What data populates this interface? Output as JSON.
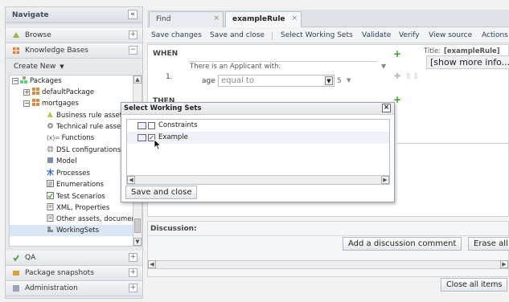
{
  "nav": {
    "title": "Navigate",
    "collapse_icon": "double-chevron-left-icon",
    "sections": {
      "browse": "Browse",
      "knowledge_bases": "Knowledge Bases",
      "create_new": "Create New",
      "qa": "QA",
      "package_snapshots": "Package snapshots",
      "administration": "Administration"
    },
    "tree": {
      "packages": "Packages",
      "default_package": "defaultPackage",
      "mortgages": "mortgages",
      "items": [
        "Business rule assets",
        "Technical rule assets",
        "Functions",
        "DSL configurations",
        "Model",
        "Processes",
        "Enumerations",
        "Test Scenarios",
        "XML, Properties",
        "Other assets, documenta",
        "WorkingSets"
      ],
      "functions_prefix": "(x)="
    }
  },
  "tabs": [
    {
      "label": "Find"
    },
    {
      "label": "exampleRule"
    }
  ],
  "toolbar": {
    "save_changes": "Save changes",
    "save_and_close": "Save and close",
    "select_working_sets": "Select Working Sets",
    "validate": "Validate",
    "verify": "Verify",
    "view_source": "View source",
    "actions": "Actions"
  },
  "editor": {
    "when": "WHEN",
    "then": "THEN",
    "condition_text": "There is an Applicant with:",
    "row_number": "1.",
    "field": "age",
    "operator": "equal to",
    "value": "5",
    "title_label": "Title:",
    "title_value": "[exampleRule]",
    "show_more": "[show more info..."
  },
  "discussion": {
    "label": "Discussion:",
    "add_comment": "Add a discussion comment",
    "erase_all": "Erase all",
    "close_all_items": "Close all items"
  },
  "dialog": {
    "title": "Select Working Sets",
    "rows": [
      {
        "label": "Constraints",
        "checked": false
      },
      {
        "label": "Example",
        "checked": true
      }
    ],
    "save_and_close": "Save and close"
  },
  "colors": {
    "accent_green": "#3a9d28",
    "toolbar_text": "#2b3e58",
    "selected_row": "#dbe6f5"
  }
}
